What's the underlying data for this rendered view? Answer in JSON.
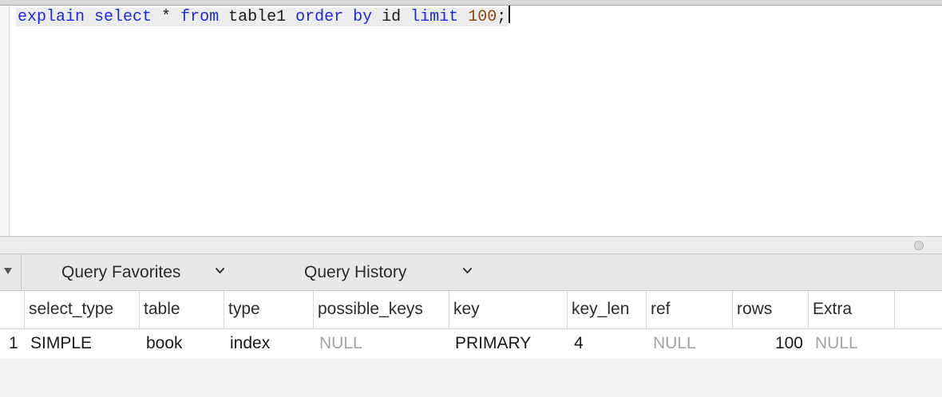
{
  "editor": {
    "tokens": [
      {
        "text": "explain",
        "kind": "kw"
      },
      {
        "text": " ",
        "kind": "plain"
      },
      {
        "text": "select",
        "kind": "kw"
      },
      {
        "text": " * ",
        "kind": "plain"
      },
      {
        "text": "from",
        "kind": "kw"
      },
      {
        "text": " table1 ",
        "kind": "plain"
      },
      {
        "text": "order",
        "kind": "kw"
      },
      {
        "text": " ",
        "kind": "plain"
      },
      {
        "text": "by",
        "kind": "kw"
      },
      {
        "text": " id ",
        "kind": "plain"
      },
      {
        "text": "limit",
        "kind": "kw"
      },
      {
        "text": " ",
        "kind": "plain"
      },
      {
        "text": "100",
        "kind": "num"
      },
      {
        "text": ";",
        "kind": "plain"
      }
    ],
    "colors": {
      "keyword": "#1d2bd6",
      "number": "#8a4a10",
      "line_highlight": "#ececec"
    }
  },
  "query_bar": {
    "favorites_label": "Query Favorites",
    "history_label": "Query History",
    "collapse_icon": "disclosure-triangle-down",
    "dropdown_icon": "chevron-down"
  },
  "results": {
    "columns": [
      "select_type",
      "table",
      "type",
      "possible_keys",
      "key",
      "key_len",
      "ref",
      "rows",
      "Extra"
    ],
    "rows": [
      {
        "row_number": "1",
        "select_type": "SIMPLE",
        "table": "book",
        "type": "index",
        "possible_keys": "NULL",
        "key": "PRIMARY",
        "key_len": "4",
        "ref": "NULL",
        "rows": "100",
        "Extra": "NULL"
      }
    ],
    "null_color": "#a4a4a4"
  }
}
